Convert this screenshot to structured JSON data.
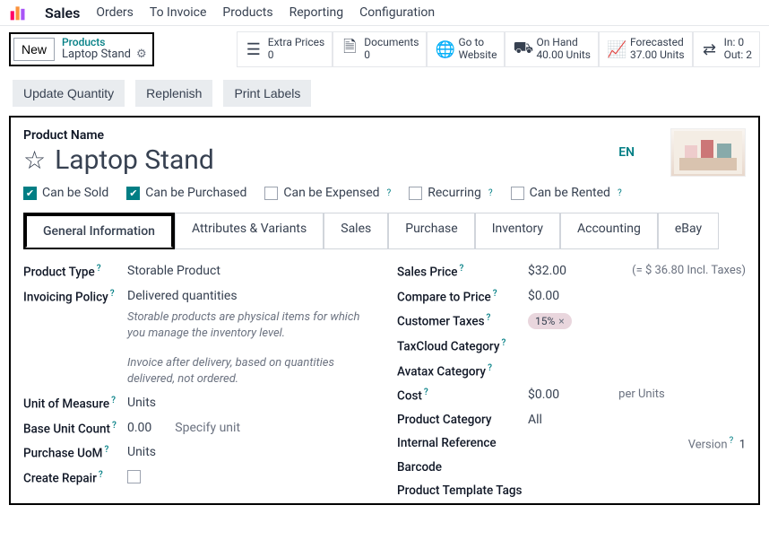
{
  "nav": {
    "app": "Sales",
    "items": [
      "Orders",
      "To Invoice",
      "Products",
      "Reporting",
      "Configuration"
    ]
  },
  "crumb": {
    "new": "New",
    "parent": "Products",
    "current": "Laptop Stand"
  },
  "stats": {
    "extra_prices": {
      "label": "Extra Prices",
      "value": "0"
    },
    "documents": {
      "label": "Documents",
      "value": "0"
    },
    "go_to": {
      "line1": "Go to",
      "line2": "Website"
    },
    "on_hand": {
      "label": "On Hand",
      "value": "40.00 Units"
    },
    "forecasted": {
      "label": "Forecasted",
      "value": "37.00 Units"
    },
    "in_out": {
      "line1": "In: 0",
      "line2": "Out: 2"
    }
  },
  "actions": {
    "update_qty": "Update Quantity",
    "replenish": "Replenish",
    "print_labels": "Print Labels"
  },
  "form": {
    "product_name_label": "Product Name",
    "product_name": "Laptop Stand",
    "lang": "EN",
    "checks": {
      "sold": "Can be Sold",
      "purchased": "Can be Purchased",
      "expensed": "Can be Expensed",
      "recurring": "Recurring",
      "rented": "Can be Rented"
    },
    "tabs": [
      "General Information",
      "Attributes & Variants",
      "Sales",
      "Purchase",
      "Inventory",
      "Accounting",
      "eBay"
    ],
    "left": {
      "product_type": {
        "label": "Product Type",
        "value": "Storable Product"
      },
      "invoicing_policy": {
        "label": "Invoicing Policy",
        "value": "Delivered quantities"
      },
      "hint1": "Storable products are physical items for which you manage the inventory level.",
      "hint2": "Invoice after delivery, based on quantities delivered, not ordered.",
      "uom": {
        "label": "Unit of Measure",
        "value": "Units"
      },
      "base_unit": {
        "label": "Base Unit Count",
        "value": "0.00",
        "specify": "Specify unit"
      },
      "purchase_uom": {
        "label": "Purchase UoM",
        "value": "Units"
      },
      "create_repair": {
        "label": "Create Repair"
      }
    },
    "right": {
      "sales_price": {
        "label": "Sales Price",
        "value": "$32.00",
        "incl": "(= $ 36.80 Incl. Taxes)"
      },
      "compare": {
        "label": "Compare to Price",
        "value": "$0.00"
      },
      "taxes": {
        "label": "Customer Taxes",
        "value": "15%"
      },
      "taxcloud": {
        "label": "TaxCloud Category"
      },
      "avatax": {
        "label": "Avatax Category"
      },
      "cost": {
        "label": "Cost",
        "value": "$0.00",
        "per": "per Units"
      },
      "category": {
        "label": "Product Category",
        "value": "All"
      },
      "internal_ref": {
        "label": "Internal Reference",
        "version_label": "Version",
        "version_value": "1"
      },
      "barcode": {
        "label": "Barcode"
      },
      "template_tags": {
        "label": "Product Template Tags"
      }
    }
  }
}
